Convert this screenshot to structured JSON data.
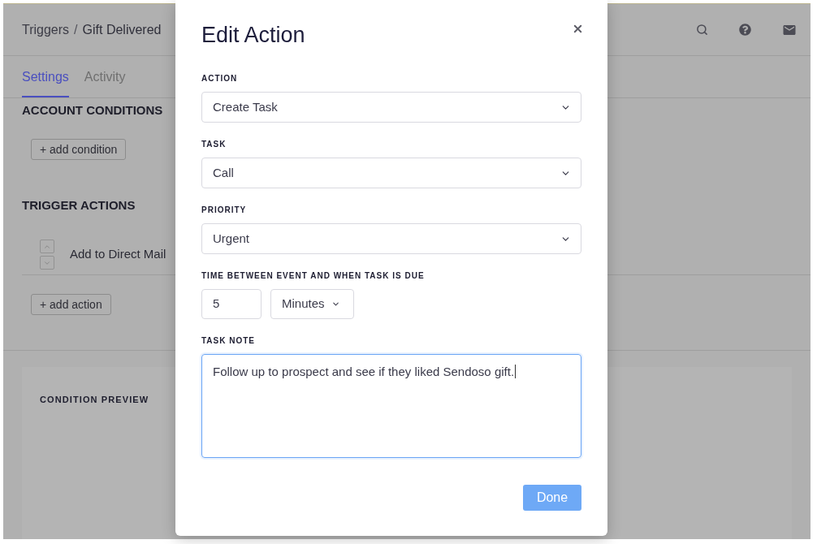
{
  "header": {
    "breadcrumb": {
      "parent": "Triggers",
      "separator": "/",
      "current": "Gift Delivered"
    }
  },
  "tabs": [
    {
      "label": "Settings",
      "selected": true
    },
    {
      "label": "Activity",
      "selected": false
    }
  ],
  "account_conditions": {
    "title": "ACCOUNT CONDITIONS",
    "add_button": "+ add condition"
  },
  "trigger_actions": {
    "title": "TRIGGER ACTIONS",
    "actions": [
      {
        "name": "Add to Direct Mail"
      }
    ],
    "add_button": "+ add action"
  },
  "condition_preview": {
    "title": "CONDITION PREVIEW"
  },
  "modal": {
    "title": "Edit Action",
    "fields": [
      {
        "kind": "select",
        "label": "ACTION",
        "value": "Create Task"
      },
      {
        "kind": "select",
        "label": "TASK",
        "value": "Call"
      },
      {
        "kind": "select",
        "label": "PRIORITY",
        "value": "Urgent"
      },
      {
        "kind": "duration",
        "label": "TIME BETWEEN EVENT AND WHEN TASK IS DUE",
        "amount": "5",
        "unit": "Minutes"
      },
      {
        "kind": "textarea",
        "label": "TASK NOTE",
        "value": "Follow up to prospect and see if they liked Sendoso gift.",
        "focused": true
      }
    ],
    "done_button": "Done"
  }
}
